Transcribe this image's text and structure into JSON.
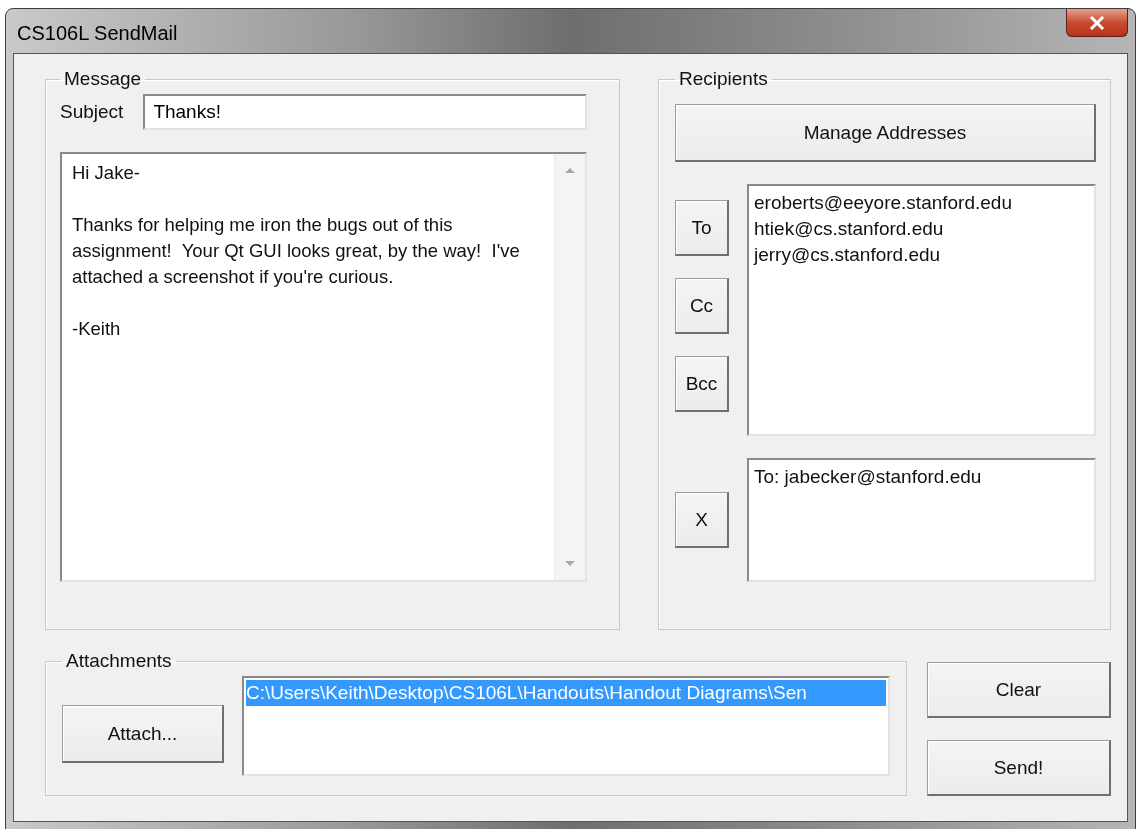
{
  "window": {
    "title": "CS106L SendMail"
  },
  "message": {
    "group_label": "Message",
    "subject_label": "Subject",
    "subject_value": "Thanks!",
    "body": [
      "Hi Jake-",
      "Thanks for helping me iron the bugs out of this assignment!  Your Qt GUI looks great, by the way!  I've attached a screenshot if you're curious.",
      "-Keith"
    ]
  },
  "recipients": {
    "group_label": "Recipients",
    "manage_button": "Manage Addresses",
    "address_buttons": [
      "To",
      "Cc",
      "Bcc"
    ],
    "addresses": [
      {
        "text": "eroberts@eeyore.stanford.edu",
        "selected": false
      },
      {
        "text": "htiek@cs.stanford.edu",
        "selected": false
      },
      {
        "text": "jerry@cs.stanford.edu",
        "selected": false
      }
    ],
    "remove_button": "X",
    "chosen": [
      {
        "text": "To: jabecker@stanford.edu",
        "selected": false
      }
    ]
  },
  "attachments": {
    "group_label": "Attachments",
    "attach_button": "Attach...",
    "files": [
      {
        "text": "C:\\Users\\Keith\\Desktop\\CS106L\\Handouts\\Handout Diagrams\\Sen",
        "selected": true
      }
    ]
  },
  "buttons": [
    "Clear",
    "Send!"
  ]
}
